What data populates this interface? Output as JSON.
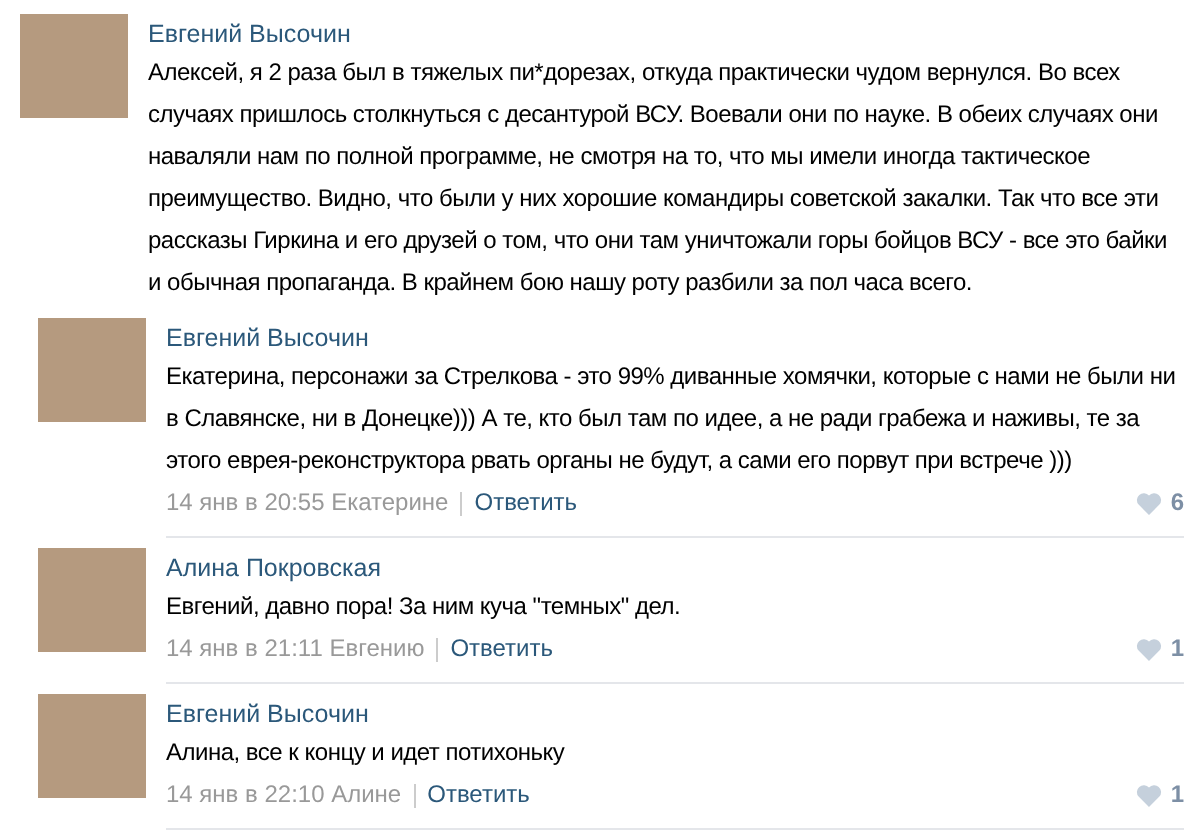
{
  "comment": {
    "author": "Евгений Высочин",
    "text": "Алексей, я 2 раза был в тяжелых пи*дорезах, откуда практически чудом вернулся. Во всех случаях пришлось столкнуться с десантурой ВСУ. Воевали они по науке. В обеих случаях они наваляли нам по полной программе, не смотря на то, что мы имели иногда тактическое преимущество. Видно, что были у них хорошие командиры советской закалки. Так что все эти рассказы Гиркина и его друзей о том, что они там уничтожали горы бойцов ВСУ - все это байки и обычная пропаганда. В крайнем бою нашу роту разбили за пол часа всего.",
    "children": [
      {
        "author": "Евгений Высочин",
        "text": "Екатерина, персонажи за Стрелкова - это 99% диванные хомячки, которые с нами не были ни в Славянске, ни в Донецке))) А те, кто был там по идее, а не ради грабежа и наживы, те за этого еврея-реконструктора рвать органы не будут, а сами его порвут при встрече )))",
        "date": "14 янв в 20:55",
        "addressee": "Екатерине",
        "reply": "Ответить",
        "likes": "6"
      },
      {
        "author": "Алина Покровская",
        "text": "Евгений, давно пора! За ним куча \"темных\" дел.",
        "date": "14 янв в 21:11",
        "addressee": "Евгению",
        "reply": "Ответить",
        "likes": "1"
      },
      {
        "author": "Евгений Высочин",
        "text": "Алина, все к концу и идет потихоньку",
        "date": "14 янв в 22:10",
        "addressee": "Алине",
        "reply": "Ответить",
        "likes": "1"
      }
    ]
  }
}
